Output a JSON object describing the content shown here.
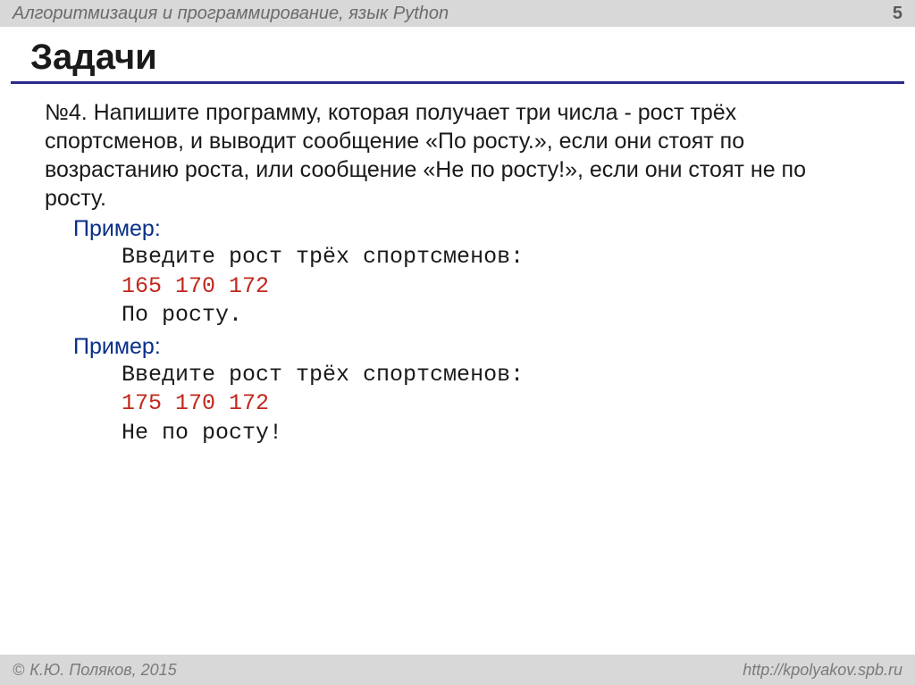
{
  "header": {
    "title": "Алгоритмизация и программирование, язык Python",
    "page": "5"
  },
  "heading": "Задачи",
  "problem": {
    "prefix": "№4.",
    "text": "Напишите программу, которая получает три числа  - рост трёх спортсменов, и выводит сообщение «По росту.», если они стоят по возрастанию роста, или сообщение «Не по росту!», если они стоят не по росту."
  },
  "example_label": "Пример",
  "example1": {
    "prompt": "Введите рост трёх спортсменов:",
    "input": "165 170 172",
    "output": "По росту."
  },
  "example2": {
    "prompt": "Введите рост трёх спортсменов:",
    "input": "175 170 172",
    "output": "Не по росту!"
  },
  "footer": {
    "copyright": "К.Ю. Поляков, 2015",
    "url": "http://kpolyakov.spb.ru"
  }
}
